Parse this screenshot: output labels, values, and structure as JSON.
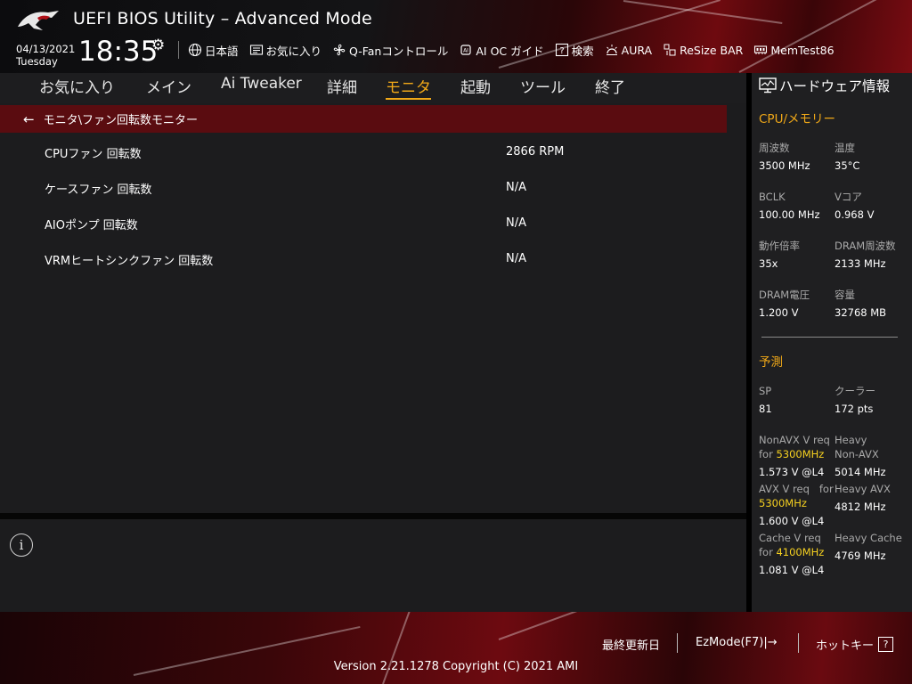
{
  "header": {
    "title": "UEFI BIOS Utility – Advanced Mode",
    "date": "04/13/2021",
    "weekday": "Tuesday",
    "time": "18:35",
    "tools": [
      {
        "label": "日本語",
        "icon": "globe-icon"
      },
      {
        "label": "お気に入り",
        "icon": "favorites-icon"
      },
      {
        "label": "Q-Fanコントロール",
        "icon": "fan-icon"
      },
      {
        "label": "AI OC ガイド",
        "icon": "ai-chip-icon"
      },
      {
        "label": "検索",
        "icon": "help-question-icon"
      },
      {
        "label": "AURA",
        "icon": "aura-light-icon"
      },
      {
        "label": "ReSize BAR",
        "icon": "resize-bar-icon"
      },
      {
        "label": "MemTest86",
        "icon": "memory-icon"
      }
    ]
  },
  "nav": {
    "tabs": [
      {
        "label": "お気に入り"
      },
      {
        "label": "メイン"
      },
      {
        "label": "Ai Tweaker"
      },
      {
        "label": "詳細"
      },
      {
        "label": "モニタ",
        "active": true
      },
      {
        "label": "起動"
      },
      {
        "label": "ツール"
      },
      {
        "label": "終了"
      }
    ]
  },
  "main": {
    "breadcrumb": "モニタ\\ファン回転数モニター",
    "rows": [
      {
        "label": "CPUファン 回転数",
        "value": "2866 RPM"
      },
      {
        "label": "ケースファン 回転数",
        "value": "N/A"
      },
      {
        "label": "AIOポンプ 回転数",
        "value": "N/A"
      },
      {
        "label": "VRMヒートシンクファン 回転数",
        "value": "N/A"
      }
    ]
  },
  "side": {
    "title": "ハードウェア情報",
    "cpu_title": "CPU/メモリー",
    "freq_label": "周波数",
    "freq_value": "3500 MHz",
    "temp_label": "温度",
    "temp_value": "35°C",
    "bclk_label": "BCLK",
    "bclk_value": "100.00 MHz",
    "vcore_label": "Vコア",
    "vcore_value": "0.968 V",
    "ratio_label": "動作倍率",
    "ratio_value": "35x",
    "dramfreq_label": "DRAM周波数",
    "dramfreq_value": "2133 MHz",
    "dramv_label": "DRAM電圧",
    "dramv_value": "1.200 V",
    "cap_label": "容量",
    "cap_value": "32768 MB",
    "predict_title": "予測",
    "sp_label": "SP",
    "sp_value": "81",
    "cooler_label": "クーラー",
    "cooler_value": "172 pts",
    "nonavx_label1": "NonAVX V req",
    "nonavx_for": "for",
    "nonavx_mhz": "5300MHz",
    "nonavx_value": "1.573 V @L4",
    "heavy_nonavx_label1": "Heavy",
    "heavy_nonavx_label2": "Non-AVX",
    "heavy_nonavx_value": "5014 MHz",
    "avx_label1": "AVX V req",
    "avx_for": "for",
    "avx_mhz": "5300MHz",
    "avx_value": "1.600 V @L4",
    "heavy_avx_label": "Heavy AVX",
    "heavy_avx_value": "4812 MHz",
    "cache_label1": "Cache V req",
    "cache_for": "for",
    "cache_mhz": "4100MHz",
    "cache_value": "1.081 V @L4",
    "heavy_cache_label": "Heavy Cache",
    "heavy_cache_value": "4769 MHz"
  },
  "footer": {
    "last_modified": "最終更新日",
    "ezmode": "EzMode(F7)|",
    "hotkeys": "ホットキー",
    "version": "Version 2.21.1278 Copyright (C) 2021 AMI"
  },
  "colors": {
    "accent": "#f0a818",
    "highlight": "#f5d020",
    "breadcrumb_bg": "#5a0c10",
    "panel_bg": "#1c1c1e"
  }
}
